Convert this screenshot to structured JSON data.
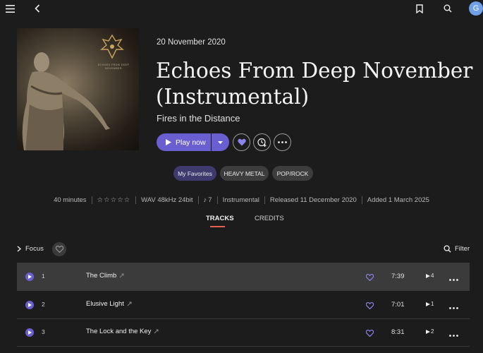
{
  "topbar": {
    "avatar_letter": "G"
  },
  "album": {
    "release_date": "20 November 2020",
    "title": "Echoes From Deep November (Instrumental)",
    "artist": "Fires in the Distance",
    "cover_caption": "ECHOES FROM DEEP NOVEMBER",
    "accent_color": "#6a5fd1"
  },
  "actions": {
    "play_label": "Play now"
  },
  "chips": [
    "My Favorites",
    "HEAVY METAL",
    "POP/ROCK"
  ],
  "meta": {
    "duration": "40 minutes",
    "stars": "☆☆☆☆☆",
    "quality": "WAV 48kHz 24bit",
    "track_count_icon": "♪",
    "track_count": "7",
    "type": "Instrumental",
    "released": "Released 11 December 2020",
    "added": "Added 1 March 2025"
  },
  "tabs": {
    "tracks": "TRACKS",
    "credits": "CREDITS"
  },
  "toolbar": {
    "focus": "Focus",
    "filter": "Filter"
  },
  "tracks": [
    {
      "number": "1",
      "title": "The Climb",
      "duration": "7:39",
      "plays": "4",
      "active": true
    },
    {
      "number": "2",
      "title": "Elusive Light",
      "duration": "7:01",
      "plays": "1",
      "active": false
    },
    {
      "number": "3",
      "title": "The Lock and the Key",
      "duration": "8:31",
      "plays": "2",
      "active": false
    }
  ]
}
